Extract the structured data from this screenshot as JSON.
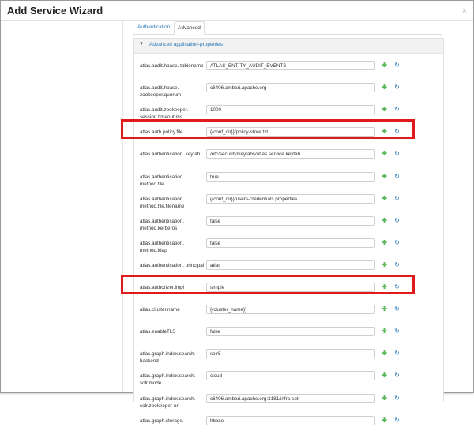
{
  "modal": {
    "title": "Add Service Wizard",
    "close": "×"
  },
  "tabs": [
    {
      "label": "Authentication"
    },
    {
      "label": "Advanced"
    }
  ],
  "panel": {
    "caret": "▼",
    "title": "Advanced application-properties"
  },
  "icons": {
    "plus": "add-override-icon",
    "refresh": "reset-icon"
  },
  "colors": {
    "highlight": "#e01b1b",
    "link": "#2a78b5",
    "plus": "#5cb85c"
  },
  "properties": [
    {
      "label": "atlas.audit.hbase. tablename",
      "value": "ATLAS_ENTITY_AUDIT_EVENTS"
    },
    {
      "label": "atlas.audit.hbase. zookeeper.quorum",
      "value": "c6406.ambari.apache.org"
    },
    {
      "label": "atlas.audit.zookeeper. session.timeout.ms",
      "value": "1000"
    },
    {
      "label": "atlas.auth.policy.file",
      "value": "{{conf_dir}}/policy-store.txt",
      "highlighted": true
    },
    {
      "label": "atlas.authentication. keytab",
      "value": "/etc/security/keytabs/atlas.service.keytab"
    },
    {
      "label": "atlas.authentication. method.file",
      "value": "true"
    },
    {
      "label": "atlas.authentication. method.file.filename",
      "value": "{{conf_dir}}/users-credentials.properties"
    },
    {
      "label": "atlas.authentication. method.kerberos",
      "value": "false"
    },
    {
      "label": "atlas.authentication. method.ldap",
      "value": "false"
    },
    {
      "label": "atlas.authentication. principal",
      "value": "atlas"
    },
    {
      "label": "atlas.authorizer.impl",
      "value": "simple",
      "highlighted": true
    },
    {
      "label": "atlas.cluster.name",
      "value": "{{cluster_name}}"
    },
    {
      "label": "atlas.enableTLS",
      "value": "false"
    },
    {
      "label": "atlas.graph.index.search. backend",
      "value": "solr5"
    },
    {
      "label": "atlas.graph.index.search. solr.mode",
      "value": "cloud"
    },
    {
      "label": "atlas.graph.index.search. solr.zookeeper-url",
      "value": "c6406.ambari.apache.org:2181/infra-solr"
    },
    {
      "label": "atlas.graph.storage.",
      "value": "hbase"
    }
  ]
}
